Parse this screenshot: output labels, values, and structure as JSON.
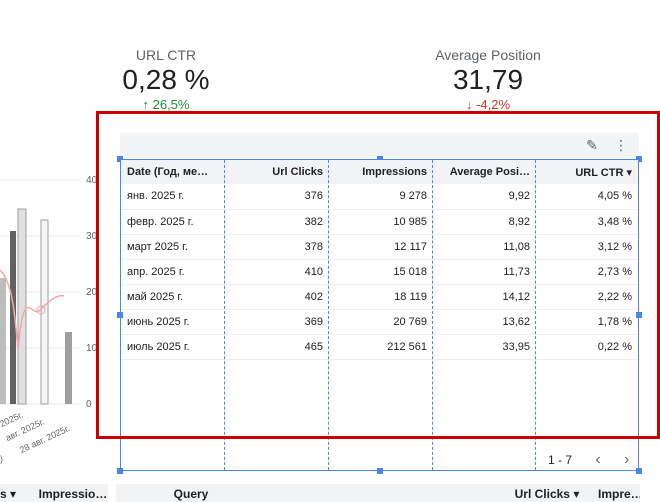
{
  "scorecards": {
    "ctr": {
      "label": "URL CTR",
      "value": "0,28 %",
      "delta": "↑ 26,5%"
    },
    "position": {
      "label": "Average Position",
      "value": "31,79",
      "delta": "↓ -4,2%"
    }
  },
  "left_chart": {
    "y_ticks": [
      "40",
      "30",
      "20",
      "10",
      "0"
    ],
    "x_labels": [
      "2025г.",
      "авг. 2025г.",
      "28 авг. 2025г."
    ],
    "fragment_label": ")"
  },
  "table": {
    "headers": [
      "Date (Год, ме…",
      "Url Clicks",
      "Impressions",
      "Average Posi…",
      "URL CTR"
    ],
    "sort_indicator": "▾",
    "rows": [
      [
        "янв. 2025 г.",
        "376",
        "9 278",
        "9,92",
        "4,05 %"
      ],
      [
        "февр. 2025 г.",
        "382",
        "10 985",
        "8,92",
        "3,48 %"
      ],
      [
        "март 2025 г.",
        "378",
        "12 117",
        "11,08",
        "3,12 %"
      ],
      [
        "апр. 2025 г.",
        "410",
        "15 018",
        "11,73",
        "2,73 %"
      ],
      [
        "май 2025 г.",
        "402",
        "18 119",
        "14,12",
        "2,22 %"
      ],
      [
        "июнь 2025 г.",
        "369",
        "20 769",
        "13,62",
        "1,78 %"
      ],
      [
        "июль 2025 г.",
        "465",
        "212 561",
        "33,95",
        "0,22 %"
      ]
    ],
    "pagination": "1 - 7",
    "prev_icon": "‹",
    "next_icon": "›",
    "edit_icon": "✎",
    "more_icon": "⋮"
  },
  "bottom_left_table": {
    "headers": [
      "s ▾",
      "Impressio…"
    ]
  },
  "bottom_right_table": {
    "headers": [
      "Query",
      "Url Clicks ▾",
      "Impre…"
    ]
  },
  "colors": {
    "highlight": "#cc0000",
    "selection": "#4a86e8",
    "positive": "#1e8e3e",
    "negative": "#d93025"
  }
}
